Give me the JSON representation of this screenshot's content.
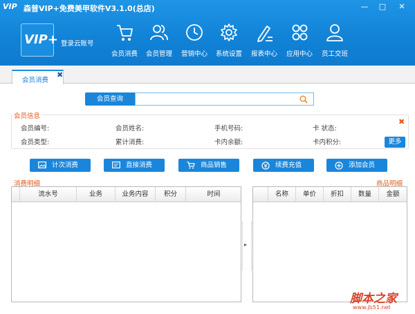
{
  "titlebar": {
    "logo_text": "VIP",
    "title": "森普VIP+免费美甲软件V3.1.0(总店)",
    "minimize": "—",
    "restore": "□",
    "close": "✕"
  },
  "brand": {
    "logo_text": "VIP+",
    "login_label": "登录云账号"
  },
  "nav": [
    {
      "label": "会员消费",
      "icon": "cart-icon"
    },
    {
      "label": "会员管理",
      "icon": "users-icon"
    },
    {
      "label": "营销中心",
      "icon": "clock-icon"
    },
    {
      "label": "系统设置",
      "icon": "gear-icon"
    },
    {
      "label": "报表中心",
      "icon": "report-pen-icon"
    },
    {
      "label": "应用中心",
      "icon": "apps-grid-icon"
    },
    {
      "label": "员工交班",
      "icon": "employee-icon"
    }
  ],
  "tabs": [
    {
      "label": "会员消费",
      "close": "✖"
    }
  ],
  "search": {
    "button_label": "会员查询",
    "value": "",
    "placeholder": ""
  },
  "member_info": {
    "title": "会员信息",
    "fields": {
      "card_no": "会员编号:",
      "name": "会员姓名:",
      "phone": "手机号码:",
      "card_status": "卡 状态:",
      "type": "会员类型:",
      "total_consume": "累计消费:",
      "balance": "卡内余额:",
      "points": "卡内积分:"
    },
    "close": "✖",
    "more_label": "更多"
  },
  "actions": [
    {
      "label": "计次消费",
      "icon": "image-icon"
    },
    {
      "label": "直接消费",
      "icon": "mail-icon"
    },
    {
      "label": "商品销售",
      "icon": "cart-icon"
    },
    {
      "label": "续费充值",
      "icon": "recharge-icon"
    },
    {
      "label": "添加会员",
      "icon": "plus-circle-icon"
    }
  ],
  "consume_detail": {
    "title": "消费明细",
    "columns": [
      "流水号",
      "业务",
      "业务内容",
      "积分",
      "时间"
    ]
  },
  "product_detail": {
    "title": "商品明细",
    "columns": [
      "名称",
      "单价",
      "折扣",
      "数量",
      "金额"
    ]
  },
  "splitter_arrow": "▸",
  "watermark": {
    "logo": "脚本之家",
    "url": "www.jb51.net"
  },
  "colors": {
    "header_blue": "#1182d6",
    "button_blue": "#1a86db",
    "accent_orange": "#e05a1a"
  }
}
